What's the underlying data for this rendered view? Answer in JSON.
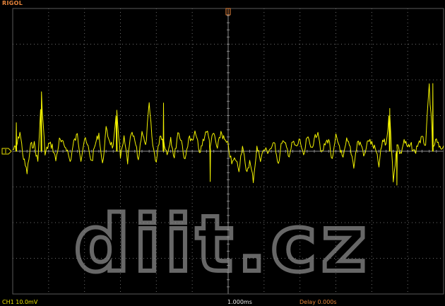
{
  "scope": {
    "brand": "RIGOL",
    "channel_readout": "CH1 10.0mV",
    "timebase_readout": "1.000ms",
    "delay_readout": "Delay 0.000s",
    "watermark": "diit.cz",
    "colors": {
      "background": "#000000",
      "grid": "#6e6e6e",
      "trace": "#f2f200",
      "brand": "#e8853b",
      "channel_text": "#e8e000",
      "delay_text": "#e8853b",
      "watermark": "#8a8a8a"
    },
    "icons": {
      "trigger_position_marker": "trigger-position-marker-icon",
      "channel_ground_marker": "ch1-ground-marker-icon"
    }
  },
  "chart_data": {
    "type": "line",
    "title": "",
    "xlabel": "",
    "ylabel": "",
    "timebase": "1.000ms/div",
    "vertical_scale": "10.0mV/div",
    "divisions": {
      "x": 12,
      "y": 8
    },
    "xlim": [
      -6,
      6
    ],
    "ylim": [
      -4,
      4
    ],
    "series": [
      {
        "x": [
          -6.0,
          -5.9,
          -5.8,
          -5.7,
          -5.6,
          -5.5,
          -5.4,
          -5.3,
          -5.2,
          -5.1,
          -5.0,
          -4.9,
          -4.8,
          -4.7,
          -4.6,
          -4.5,
          -4.4,
          -4.3,
          -4.2,
          -4.1,
          -4.0,
          -3.9,
          -3.8,
          -3.7,
          -3.6,
          -3.5,
          -3.4,
          -3.3,
          -3.2,
          -3.1,
          -3.0,
          -2.9,
          -2.8,
          -2.7,
          -2.6,
          -2.5,
          -2.4,
          -2.3,
          -2.2,
          -2.1,
          -2.0,
          -1.9,
          -1.8,
          -1.7,
          -1.6,
          -1.5,
          -1.4,
          -1.3,
          -1.2,
          -1.1,
          -1.0,
          -0.9,
          -0.8,
          -0.7,
          -0.6,
          -0.5,
          -0.4,
          -0.3,
          -0.2,
          -0.1,
          0.0,
          0.1,
          0.2,
          0.3,
          0.4,
          0.5,
          0.6,
          0.7,
          0.8,
          0.9,
          1.0,
          1.1,
          1.2,
          1.3,
          1.4,
          1.5,
          1.6,
          1.7,
          1.8,
          1.9,
          2.0,
          2.1,
          2.2,
          2.3,
          2.4,
          2.5,
          2.6,
          2.7,
          2.8,
          2.9,
          3.0,
          3.1,
          3.2,
          3.3,
          3.4,
          3.5,
          3.6,
          3.7,
          3.8,
          3.9,
          4.0,
          4.1,
          4.2,
          4.3,
          4.4,
          4.5,
          4.6,
          4.7,
          4.8,
          4.9,
          5.0,
          5.1,
          5.2,
          5.3,
          5.4,
          5.5,
          5.6,
          5.7,
          5.8,
          5.9,
          6.0
        ],
        "y": [
          0.05,
          0.1,
          0.55,
          -0.2,
          -0.6,
          0.15,
          0.2,
          -0.3,
          1.6,
          -0.1,
          0.2,
          0.15,
          -0.25,
          0.3,
          0.2,
          0.1,
          -0.3,
          0.25,
          0.45,
          -0.2,
          0.35,
          0.1,
          -0.3,
          0.2,
          0.5,
          -0.4,
          0.6,
          0.3,
          0.1,
          1.15,
          -0.2,
          0.35,
          -0.3,
          0.5,
          0.3,
          -0.25,
          0.6,
          0.1,
          1.3,
          0.15,
          -0.3,
          0.45,
          0.35,
          -0.1,
          0.4,
          -0.2,
          0.55,
          0.3,
          -0.3,
          0.4,
          0.25,
          0.55,
          -0.1,
          0.3,
          0.6,
          0.2,
          0.5,
          0.05,
          0.55,
          0.3,
          0.15,
          -0.35,
          -0.2,
          -0.5,
          0.2,
          -0.6,
          -0.3,
          -0.8,
          0.1,
          -0.2,
          0.05,
          0.0,
          0.1,
          0.2,
          -0.35,
          0.3,
          0.15,
          -0.1,
          0.25,
          0.1,
          0.35,
          -0.2,
          0.4,
          0.1,
          0.3,
          0.6,
          -0.1,
          0.2,
          0.35,
          -0.3,
          0.4,
          0.15,
          -0.25,
          0.3,
          0.1,
          -0.4,
          0.25,
          0.2,
          -0.15,
          0.35,
          0.2,
          0.05,
          -0.4,
          0.3,
          0.2,
          1.15,
          -0.9,
          0.25,
          -0.1,
          0.3,
          0.1,
          0.15,
          -0.05,
          0.25,
          0.35,
          0.2,
          1.85,
          0.1,
          0.3,
          0.05,
          0.15
        ]
      }
    ],
    "spikes": [
      {
        "x": -5.9,
        "y": 0.8
      },
      {
        "x": -5.2,
        "y": 1.65
      },
      {
        "x": -3.1,
        "y": 1.15
      },
      {
        "x": -1.8,
        "y": 1.35
      },
      {
        "x": -0.5,
        "y": -0.85
      },
      {
        "x": 4.5,
        "y": 1.2
      },
      {
        "x": 4.7,
        "y": -0.95
      },
      {
        "x": 5.7,
        "y": 1.9
      }
    ],
    "grid": true
  }
}
